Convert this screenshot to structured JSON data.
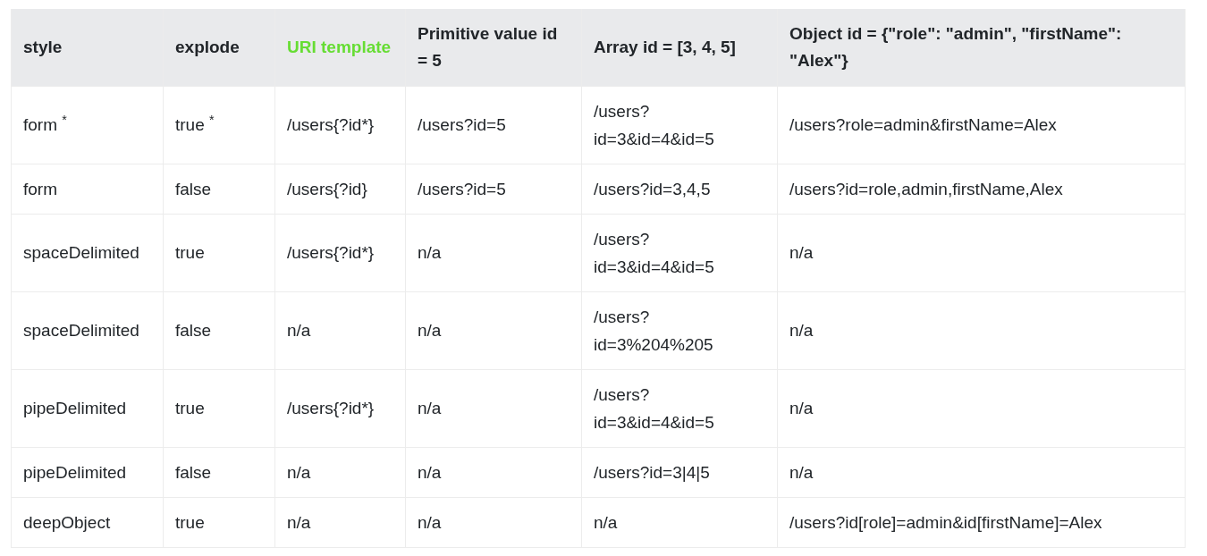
{
  "table": {
    "columns": [
      {
        "text": "style",
        "kind": "text"
      },
      {
        "text": "explode",
        "kind": "text"
      },
      {
        "text": "URI template",
        "kind": "link"
      },
      {
        "text": "Primitive value id = 5",
        "kind": "text"
      },
      {
        "text": "Array id = [3, 4, 5]",
        "kind": "text"
      },
      {
        "text": "Object id = {\"role\": \"admin\", \"firstName\": \"Alex\"}",
        "kind": "text"
      }
    ],
    "rows": [
      [
        "form $^{*}$",
        "true $^{*}$",
        "/users{?id*}",
        "/users?id=5",
        "/users?id=3&id=4&id=5",
        "/users?role=admin&firstName=Alex"
      ],
      [
        "form",
        "false",
        "/users{?id}",
        "/users?id=5",
        "/users?id=3,4,5",
        "/users?id=role,admin,firstName,Alex"
      ],
      [
        "spaceDelimited",
        "true",
        "/users{?id*}",
        "n/a",
        "/users?id=3&id=4&id=5",
        "n/a"
      ],
      [
        "spaceDelimited",
        "false",
        "n/a",
        "n/a",
        "/users?id=3%204%205",
        "n/a"
      ],
      [
        "pipeDelimited",
        "true",
        "/users{?id*}",
        "n/a",
        "/users?id=3&id=4&id=5",
        "n/a"
      ],
      [
        "pipeDelimited",
        "false",
        "n/a",
        "n/a",
        "/users?id=3|4|5",
        "n/a"
      ],
      [
        "deepObject",
        "true",
        "n/a",
        "n/a",
        "n/a",
        "/users?id[role]=admin&id[firstName]=Alex"
      ]
    ]
  }
}
